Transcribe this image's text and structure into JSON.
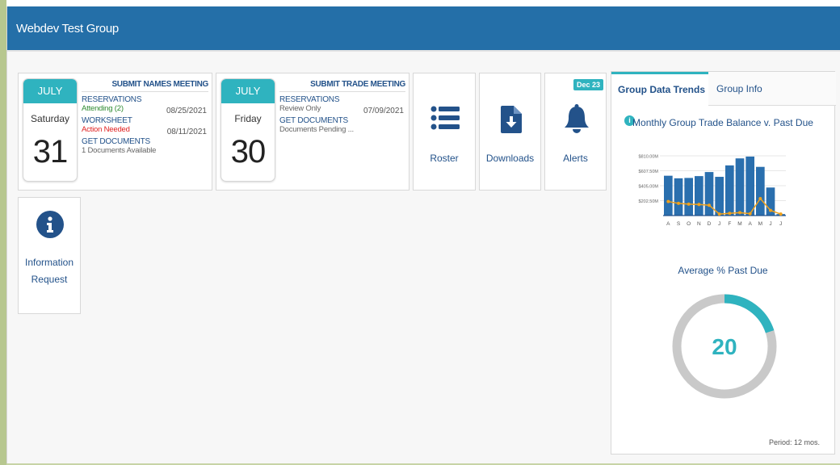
{
  "header": {
    "title": "Webdev Test Group"
  },
  "meetings": [
    {
      "title": "SUBMIT NAMES MEETING",
      "month": "JULY",
      "weekday": "Saturday",
      "day": "31",
      "reservations_label": "RESERVATIONS",
      "reservations_status": "Attending (2)",
      "reservations_date": "08/25/2021",
      "worksheet_label": "WORKSHEET",
      "worksheet_status": "Action Needed",
      "worksheet_date": "08/11/2021",
      "documents_label": "GET DOCUMENTS",
      "documents_status": "1 Documents Available"
    },
    {
      "title": "SUBMIT TRADE MEETING",
      "month": "JULY",
      "weekday": "Friday",
      "day": "30",
      "reservations_label": "RESERVATIONS",
      "reservations_status": "Review Only",
      "reservations_date": "07/09/2021",
      "documents_label": "GET DOCUMENTS",
      "documents_status": "Documents Pending ..."
    }
  ],
  "tiles": {
    "roster": "Roster",
    "downloads": "Downloads",
    "alerts": "Alerts",
    "alerts_badge": "Dec 23"
  },
  "info_request": {
    "line1": "Information",
    "line2": "Request"
  },
  "panel": {
    "tab_active": "Group Data Trends",
    "tab_inactive": "Group Info",
    "chart_title": "Monthly Group Trade Balance v. Past Due",
    "avg_title": "Average % Past Due",
    "avg_value": "20",
    "period": "Period: 12 mos."
  },
  "colors": {
    "header": "#246fa8",
    "accent": "#2fb3bf",
    "bar": "#2a6fae",
    "line": "#f0a11c",
    "link": "#23528a"
  },
  "chart_data": {
    "type": "bar",
    "categories": [
      "A",
      "S",
      "O",
      "N",
      "D",
      "J",
      "F",
      "M",
      "A",
      "M",
      "J",
      "J"
    ],
    "y_ticks": [
      "$810.00M",
      "$607.50M",
      "$405.00M",
      "$202.50M"
    ],
    "tick_values": [
      810,
      607.5,
      405,
      202.5
    ],
    "ylim": [
      0,
      810
    ],
    "series": [
      {
        "type": "bar",
        "values": [
          540,
          505,
          510,
          535,
          590,
          525,
          680,
          775,
          800,
          660,
          380,
          20
        ]
      },
      {
        "type": "line",
        "values": [
          190,
          165,
          155,
          150,
          140,
          20,
          30,
          40,
          25,
          230,
          70,
          20
        ]
      }
    ],
    "donut_percent": 20
  }
}
